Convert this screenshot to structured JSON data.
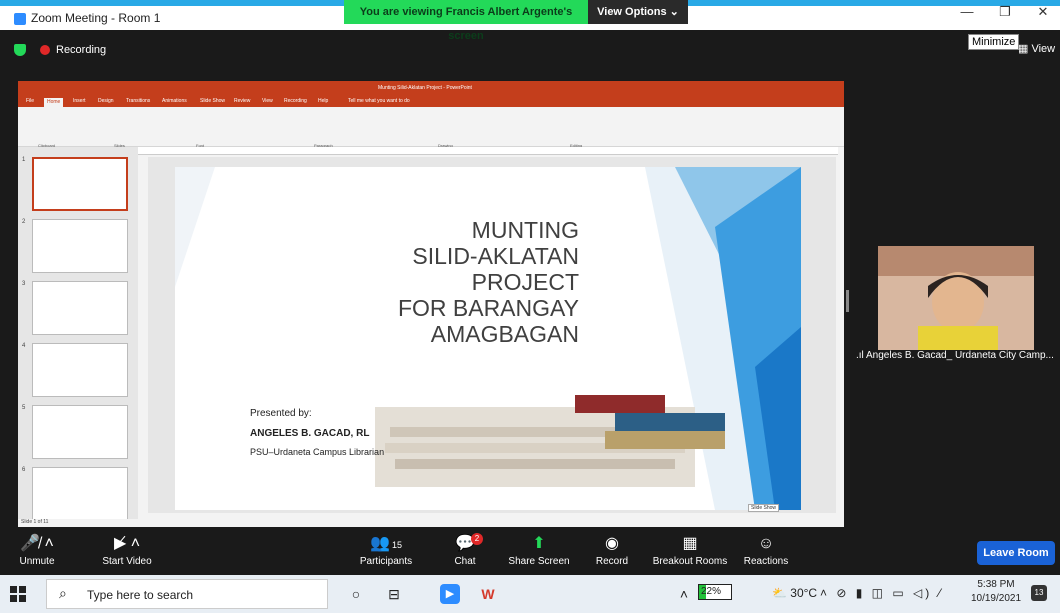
{
  "window": {
    "title": "Zoom Meeting - Room 1",
    "share_banner": "You are viewing Francis Albert Argente's screen",
    "view_options": "View Options ⌄",
    "minimize_tooltip": "Minimize",
    "view_button": "View"
  },
  "recording": {
    "label": "Recording"
  },
  "ppt": {
    "title": "Munting Silid-Aklatan Project  -  PowerPoint",
    "tabs": [
      "File",
      "Home",
      "Insert",
      "Design",
      "Transitions",
      "Animations",
      "Slide Show",
      "Review",
      "View",
      "Recording",
      "Help"
    ],
    "tell_me": "Tell me what you want to do",
    "ribbon_groups": [
      "Clipboard",
      "Slides",
      "Font",
      "Paragraph",
      "Drawing",
      "Editing"
    ],
    "status": "Slide 1 of 11",
    "slideshow_tip": "Slide Show",
    "thumb_numbers": [
      "1",
      "2",
      "3",
      "4",
      "5",
      "6"
    ]
  },
  "slide": {
    "title_lines": [
      "MUNTING",
      "SILID-AKLATAN",
      "PROJECT",
      "FOR BARANGAY",
      "AMAGBAGAN"
    ],
    "presented_by": "Presented by:",
    "presenter": "ANGELES B. GACAD, RL",
    "presenter_role": "PSU–Urdaneta Campus Librarian"
  },
  "self_view": {
    "name": "Angeles B. Gacad_ Urdaneta City Camp..."
  },
  "toolbar": {
    "unmute": "Unmute",
    "start_video": "Start Video",
    "participants": "Participants",
    "participants_count": "15",
    "chat": "Chat",
    "chat_badge": "2",
    "share_screen": "Share Screen",
    "record": "Record",
    "breakout_rooms": "Breakout Rooms",
    "reactions": "Reactions",
    "leave": "Leave Room"
  },
  "taskbar": {
    "search_placeholder": "Type here to search",
    "cpu": "22%",
    "cpu_fraction": 0.22,
    "temperature": "30°C",
    "time": "5:38 PM",
    "date": "10/19/2021",
    "notifications": "13"
  },
  "colors": {
    "zoom_share_green": "#23d959",
    "ppt_red": "#c43e1c",
    "leave_blue": "#1a62d6",
    "recording_red": "#e02828"
  }
}
